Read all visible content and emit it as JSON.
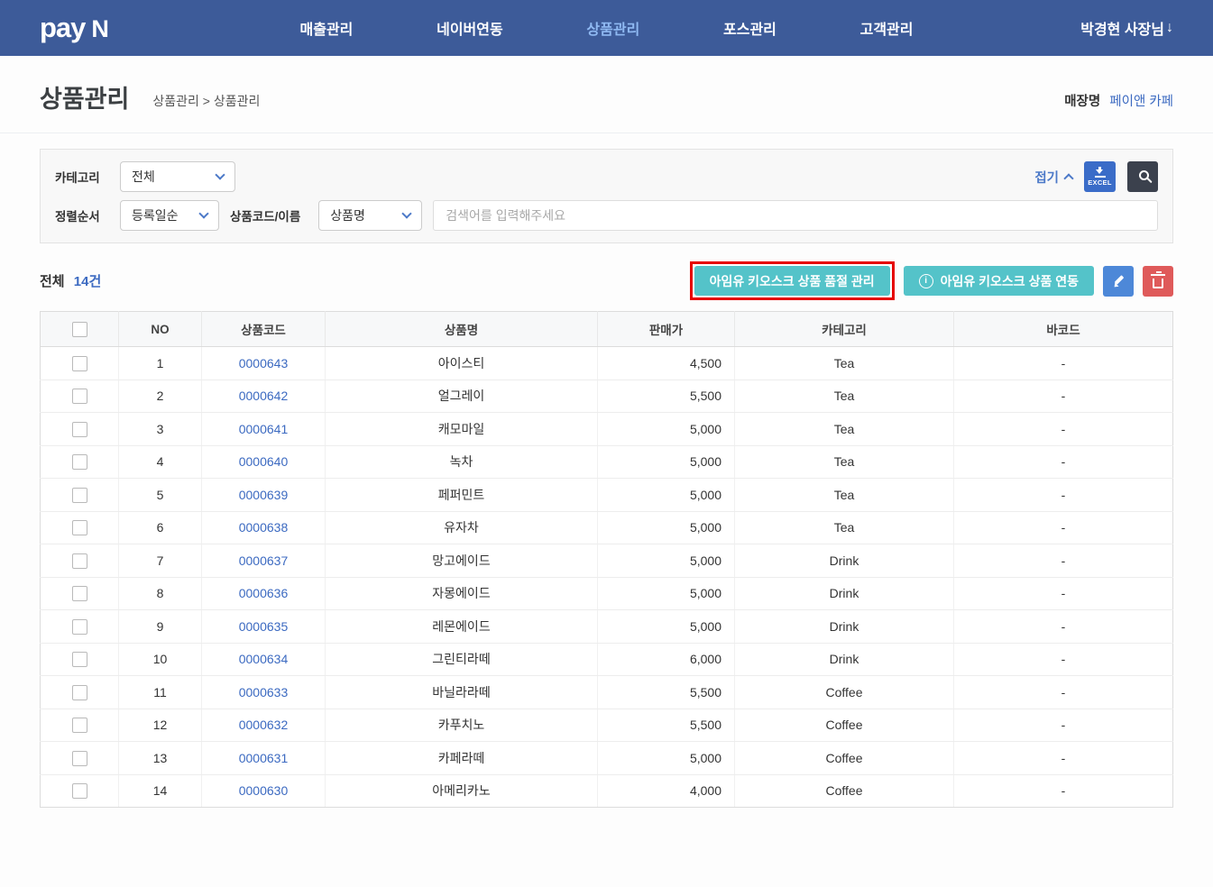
{
  "colors": {
    "navbar_blue": "#3d5b99",
    "nav_active_blue": "#8fb9f2",
    "link_blue": "#3c6ac1",
    "accent_teal": "#54c3c9",
    "highlight_red": "#e60000",
    "excel_button_blue": "#3a6cc8",
    "edit_button_blue": "#4d88d8",
    "delete_button_red": "#df5a5a"
  },
  "navbar": {
    "logo_pay": "pay",
    "logo_n": "N",
    "items": [
      {
        "label": "매출관리",
        "active": false
      },
      {
        "label": "네이버연동",
        "active": false
      },
      {
        "label": "상품관리",
        "active": true
      },
      {
        "label": "포스관리",
        "active": false
      },
      {
        "label": "고객관리",
        "active": false
      }
    ],
    "user_label": "박경현 사장님",
    "user_arrow": "↓"
  },
  "header": {
    "title": "상품관리",
    "breadcrumb": "상품관리 > 상품관리",
    "store_label": "매장명",
    "store_name": "페이앤 카페"
  },
  "filters": {
    "category_label": "카테고리",
    "category_value": "전체",
    "collapse_label": "접기",
    "excel_label": "EXCEL",
    "sort_label": "정렬순서",
    "sort_value": "등록일순",
    "code_name_label": "상품코드/이름",
    "search_field_value": "상품명",
    "search_placeholder": "검색어를 입력해주세요"
  },
  "toolbar": {
    "total_label": "전체",
    "total_count": "14건",
    "soldout_button_label": "아임유 키오스크 상품 품절 관리",
    "sync_button_label": "아임유 키오스크 상품 연동"
  },
  "table": {
    "headers": [
      "NO",
      "상품코드",
      "상품명",
      "판매가",
      "카테고리",
      "바코드"
    ],
    "rows": [
      {
        "no": "1",
        "code": "0000643",
        "name": "아이스티",
        "price": "4,500",
        "category": "Tea",
        "barcode": "-"
      },
      {
        "no": "2",
        "code": "0000642",
        "name": "얼그레이",
        "price": "5,500",
        "category": "Tea",
        "barcode": "-"
      },
      {
        "no": "3",
        "code": "0000641",
        "name": "캐모마일",
        "price": "5,000",
        "category": "Tea",
        "barcode": "-"
      },
      {
        "no": "4",
        "code": "0000640",
        "name": "녹차",
        "price": "5,000",
        "category": "Tea",
        "barcode": "-"
      },
      {
        "no": "5",
        "code": "0000639",
        "name": "페퍼민트",
        "price": "5,000",
        "category": "Tea",
        "barcode": "-"
      },
      {
        "no": "6",
        "code": "0000638",
        "name": "유자차",
        "price": "5,000",
        "category": "Tea",
        "barcode": "-"
      },
      {
        "no": "7",
        "code": "0000637",
        "name": "망고에이드",
        "price": "5,000",
        "category": "Drink",
        "barcode": "-"
      },
      {
        "no": "8",
        "code": "0000636",
        "name": "자몽에이드",
        "price": "5,000",
        "category": "Drink",
        "barcode": "-"
      },
      {
        "no": "9",
        "code": "0000635",
        "name": "레몬에이드",
        "price": "5,000",
        "category": "Drink",
        "barcode": "-"
      },
      {
        "no": "10",
        "code": "0000634",
        "name": "그린티라떼",
        "price": "6,000",
        "category": "Drink",
        "barcode": "-"
      },
      {
        "no": "11",
        "code": "0000633",
        "name": "바닐라라떼",
        "price": "5,500",
        "category": "Coffee",
        "barcode": "-"
      },
      {
        "no": "12",
        "code": "0000632",
        "name": "카푸치노",
        "price": "5,500",
        "category": "Coffee",
        "barcode": "-"
      },
      {
        "no": "13",
        "code": "0000631",
        "name": "카페라떼",
        "price": "5,000",
        "category": "Coffee",
        "barcode": "-"
      },
      {
        "no": "14",
        "code": "0000630",
        "name": "아메리카노",
        "price": "4,000",
        "category": "Coffee",
        "barcode": "-"
      }
    ]
  }
}
